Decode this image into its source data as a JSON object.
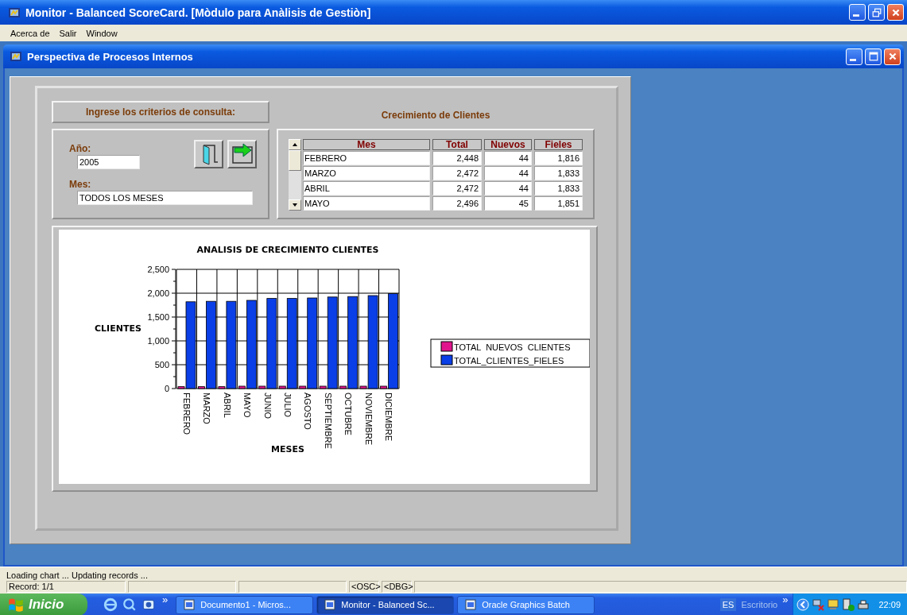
{
  "window": {
    "title": "Monitor - Balanced ScoreCard. [Mòdulo para Anàlisis de Gestiòn]"
  },
  "menu": [
    "Acerca de",
    "Salir",
    "Window"
  ],
  "child_window": {
    "title": "Perspectiva de Procesos Internos"
  },
  "criteria": {
    "heading": "Ingrese los criterios de consulta:",
    "fields": [
      {
        "label": "Año:",
        "value": "2005",
        "kind": "short"
      },
      {
        "label": "Mes:",
        "value": "TODOS LOS MESES",
        "kind": "long"
      }
    ]
  },
  "table": {
    "title": "Crecimiento de Clientes",
    "columns": [
      "Mes",
      "Total",
      "Nuevos",
      "Fieles"
    ],
    "rows": [
      [
        "FEBRERO",
        "2,448",
        "44",
        "1,816"
      ],
      [
        "MARZO",
        "2,472",
        "44",
        "1,833"
      ],
      [
        "ABRIL",
        "2,472",
        "44",
        "1,833"
      ],
      [
        "MAYO",
        "2,496",
        "45",
        "1,851"
      ]
    ]
  },
  "chart_data": {
    "type": "bar",
    "title": "ANALISIS DE CRECIMIENTO CLIENTES",
    "xlabel": "MESES",
    "ylabel": "CLIENTES",
    "categories": [
      "FEBRERO",
      "MARZO",
      "ABRIL",
      "MAYO",
      "JUNIO",
      "JULIO",
      "AGOSTO",
      "SEPTIEMBRE",
      "OCTUBRE",
      "NOVIEMBRE",
      "DICIEMBRE"
    ],
    "ylim": [
      0,
      2500
    ],
    "yticks": [
      {
        "value": 0,
        "label": "0"
      },
      {
        "value": 500,
        "label": "500"
      },
      {
        "value": 1000,
        "label": "1,000"
      },
      {
        "value": 1500,
        "label": "1,500"
      },
      {
        "value": 2000,
        "label": "2,000"
      },
      {
        "value": 2500,
        "label": "2,500"
      }
    ],
    "series": [
      {
        "name": "TOTAL  NUEVOS  CLIENTES",
        "color": "#e0148c",
        "values": [
          40,
          40,
          40,
          50,
          50,
          50,
          50,
          50,
          50,
          50,
          50
        ]
      },
      {
        "name": "TOTAL_CLIENTES_FIELES",
        "color": "#0a3ee6",
        "values": [
          1820,
          1830,
          1830,
          1850,
          1890,
          1890,
          1900,
          1920,
          1930,
          1950,
          1990
        ]
      }
    ],
    "grid": true,
    "legend": true
  },
  "status_bar": {
    "message": "Loading chart ... Updating records ...",
    "record": "Record: 1/1",
    "flags": [
      "<OSC>",
      "<DBG>"
    ]
  },
  "taskbar": {
    "start": "Inicio",
    "more": "»",
    "tasks": [
      {
        "label": "Documento1 - Micros...",
        "selected": false
      },
      {
        "label": "Monitor - Balanced Sc...",
        "selected": true
      },
      {
        "label": "Oracle Graphics Batch",
        "selected": false
      }
    ],
    "language": "ES",
    "toolbar": "Escritorio",
    "toolbar_more": "»",
    "clock": "22:09"
  }
}
